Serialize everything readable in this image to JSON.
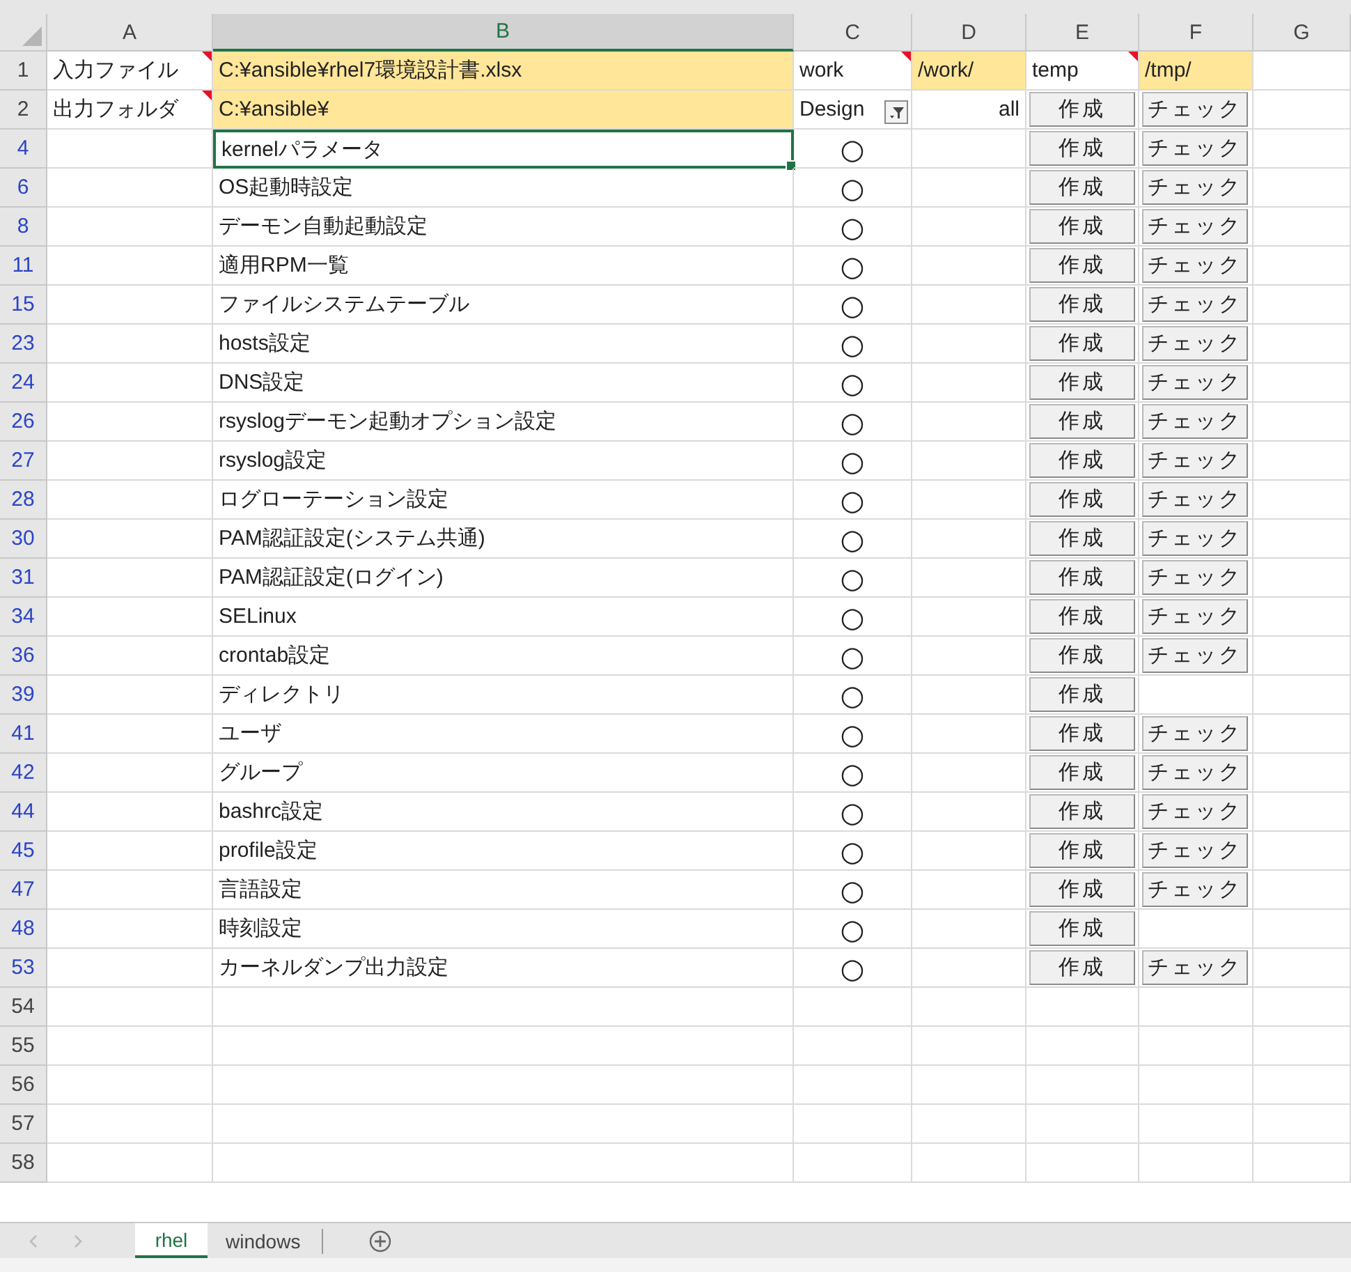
{
  "column_headers": [
    {
      "label": "A",
      "selected": false
    },
    {
      "label": "B",
      "selected": true
    },
    {
      "label": "C",
      "selected": false
    },
    {
      "label": "D",
      "selected": false
    },
    {
      "label": "E",
      "selected": false
    },
    {
      "label": "F",
      "selected": false
    },
    {
      "label": "G",
      "selected": false
    }
  ],
  "header_rows": [
    {
      "number": "1",
      "cells": [
        {
          "kind": "text",
          "text": "入力ファイル",
          "comment": true,
          "highlighted": false
        },
        {
          "kind": "text",
          "text": "C:¥ansible¥rhel7環境設計書.xlsx",
          "comment": false,
          "highlighted": true
        },
        {
          "kind": "text",
          "text": "work",
          "comment": true,
          "highlighted": false
        },
        {
          "kind": "text",
          "text": "/work/",
          "comment": false,
          "highlighted": true
        },
        {
          "kind": "text",
          "text": "temp",
          "comment": true,
          "highlighted": false
        },
        {
          "kind": "text",
          "text": "/tmp/",
          "comment": false,
          "highlighted": true
        },
        {
          "kind": "empty"
        }
      ]
    },
    {
      "number": "2",
      "cells": [
        {
          "kind": "text",
          "text": "出力フォルダ",
          "comment": true,
          "highlighted": false
        },
        {
          "kind": "text",
          "text": "C:¥ansible¥",
          "comment": false,
          "highlighted": true
        },
        {
          "kind": "filter",
          "text": "Design"
        },
        {
          "kind": "right",
          "text": "all"
        },
        {
          "kind": "button",
          "text": "作成"
        },
        {
          "kind": "button",
          "text": "チェック"
        },
        {
          "kind": "empty"
        }
      ]
    }
  ],
  "rows": [
    {
      "number": "4",
      "name": "kernelパラメータ",
      "mark": "○",
      "create_button": "作成",
      "check_button": "チェック",
      "selected": true
    },
    {
      "number": "6",
      "name": "OS起動時設定",
      "mark": "○",
      "create_button": "作成",
      "check_button": "チェック",
      "selected": false
    },
    {
      "number": "8",
      "name": "デーモン自動起動設定",
      "mark": "○",
      "create_button": "作成",
      "check_button": "チェック",
      "selected": false
    },
    {
      "number": "11",
      "name": "適用RPM一覧",
      "mark": "○",
      "create_button": "作成",
      "check_button": "チェック",
      "selected": false
    },
    {
      "number": "15",
      "name": "ファイルシステムテーブル",
      "mark": "○",
      "create_button": "作成",
      "check_button": "チェック",
      "selected": false
    },
    {
      "number": "23",
      "name": "hosts設定",
      "mark": "○",
      "create_button": "作成",
      "check_button": "チェック",
      "selected": false
    },
    {
      "number": "24",
      "name": "DNS設定",
      "mark": "○",
      "create_button": "作成",
      "check_button": "チェック",
      "selected": false
    },
    {
      "number": "26",
      "name": "rsyslogデーモン起動オプション設定",
      "mark": "○",
      "create_button": "作成",
      "check_button": "チェック",
      "selected": false
    },
    {
      "number": "27",
      "name": "rsyslog設定",
      "mark": "○",
      "create_button": "作成",
      "check_button": "チェック",
      "selected": false
    },
    {
      "number": "28",
      "name": "ログローテーション設定",
      "mark": "○",
      "create_button": "作成",
      "check_button": "チェック",
      "selected": false
    },
    {
      "number": "30",
      "name": "PAM認証設定(システム共通)",
      "mark": "○",
      "create_button": "作成",
      "check_button": "チェック",
      "selected": false
    },
    {
      "number": "31",
      "name": "PAM認証設定(ログイン)",
      "mark": "○",
      "create_button": "作成",
      "check_button": "チェック",
      "selected": false
    },
    {
      "number": "34",
      "name": "SELinux",
      "mark": "○",
      "create_button": "作成",
      "check_button": "チェック",
      "selected": false
    },
    {
      "number": "36",
      "name": "crontab設定",
      "mark": "○",
      "create_button": "作成",
      "check_button": "チェック",
      "selected": false
    },
    {
      "number": "39",
      "name": "ディレクトリ",
      "mark": "○",
      "create_button": "作成",
      "selected": false
    },
    {
      "number": "41",
      "name": "ユーザ",
      "mark": "○",
      "create_button": "作成",
      "check_button": "チェック",
      "selected": false
    },
    {
      "number": "42",
      "name": "グループ",
      "mark": "○",
      "create_button": "作成",
      "check_button": "チェック",
      "selected": false
    },
    {
      "number": "44",
      "name": "bashrc設定",
      "mark": "○",
      "create_button": "作成",
      "check_button": "チェック",
      "selected": false
    },
    {
      "number": "45",
      "name": "profile設定",
      "mark": "○",
      "create_button": "作成",
      "check_button": "チェック",
      "selected": false
    },
    {
      "number": "47",
      "name": "言語設定",
      "mark": "○",
      "create_button": "作成",
      "check_button": "チェック",
      "selected": false
    },
    {
      "number": "48",
      "name": "時刻設定",
      "mark": "○",
      "create_button": "作成",
      "selected": false
    },
    {
      "number": "53",
      "name": "カーネルダンプ出力設定",
      "mark": "○",
      "create_button": "作成",
      "check_button": "チェック",
      "selected": false
    }
  ],
  "empty_rows": [
    "54",
    "55",
    "56",
    "57",
    "58"
  ],
  "sheet_tabs": [
    {
      "label": "rhel",
      "selected": true
    },
    {
      "label": "windows",
      "selected": false
    }
  ]
}
